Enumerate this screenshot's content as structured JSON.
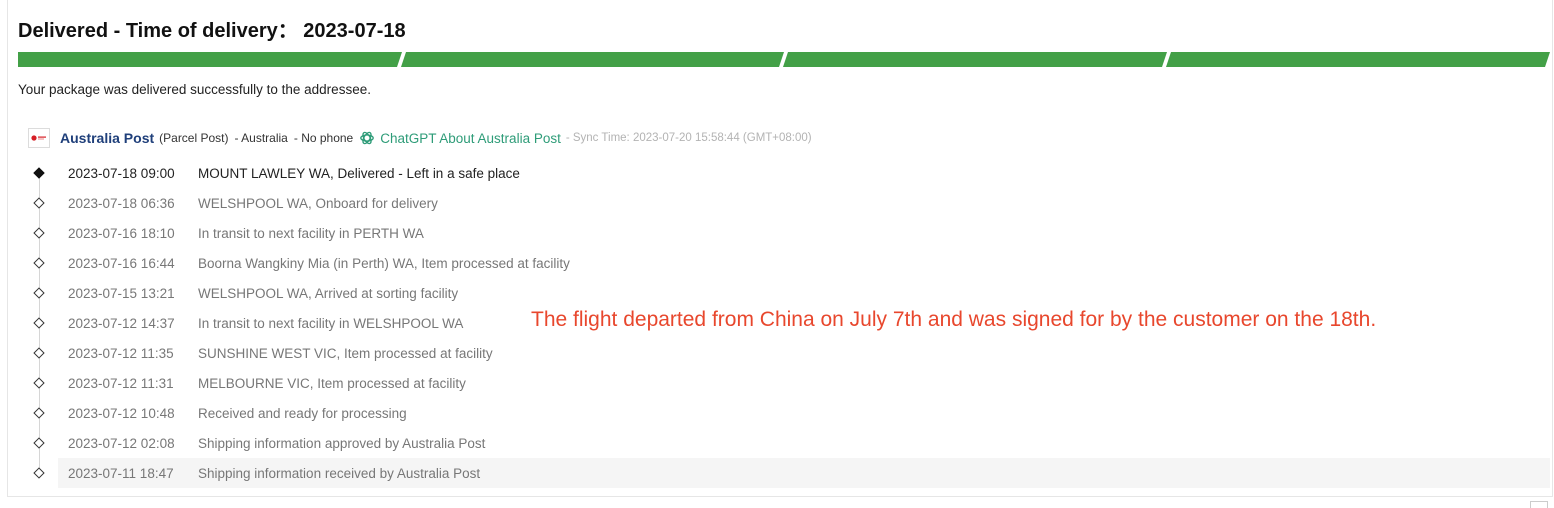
{
  "header": {
    "title": "Delivered - Time of delivery： 2023-07-18",
    "status_message": "Your package was delivered successfully to the addressee."
  },
  "progress": {
    "segments_total": 4,
    "segments_complete": 4,
    "color": "#43a047"
  },
  "carrier": {
    "logo_icon": "australia-post-logo",
    "name": "Australia Post",
    "service": "(Parcel Post)",
    "country": "- Australia",
    "phone": "- No phone",
    "chatgpt_icon": "chatgpt-icon",
    "chatgpt_link": "ChatGPT About Australia Post",
    "sync_time": "- Sync Time: 2023-07-20 15:58:44 (GMT+08:00)"
  },
  "events": [
    {
      "time": "2023-07-18 09:00",
      "desc": "MOUNT LAWLEY WA, Delivered - Left in a safe place"
    },
    {
      "time": "2023-07-18 06:36",
      "desc": "WELSHPOOL WA, Onboard for delivery"
    },
    {
      "time": "2023-07-16 18:10",
      "desc": "In transit to next facility in PERTH WA"
    },
    {
      "time": "2023-07-16 16:44",
      "desc": "Boorna Wangkiny Mia (in Perth) WA, Item processed at facility"
    },
    {
      "time": "2023-07-15 13:21",
      "desc": "WELSHPOOL WA, Arrived at sorting facility"
    },
    {
      "time": "2023-07-12 14:37",
      "desc": "In transit to next facility in WELSHPOOL WA"
    },
    {
      "time": "2023-07-12 11:35",
      "desc": "SUNSHINE WEST VIC, Item processed at facility"
    },
    {
      "time": "2023-07-12 11:31",
      "desc": "MELBOURNE VIC, Item processed at facility"
    },
    {
      "time": "2023-07-12 10:48",
      "desc": "Received and ready for processing"
    },
    {
      "time": "2023-07-12 02:08",
      "desc": "Shipping information approved by Australia Post"
    },
    {
      "time": "2023-07-11 18:47",
      "desc": "Shipping information received by Australia Post"
    }
  ],
  "annotation": {
    "text": "The flight departed from China on July 7th and was signed for by the customer on the 18th.",
    "color": "#e8472d"
  }
}
